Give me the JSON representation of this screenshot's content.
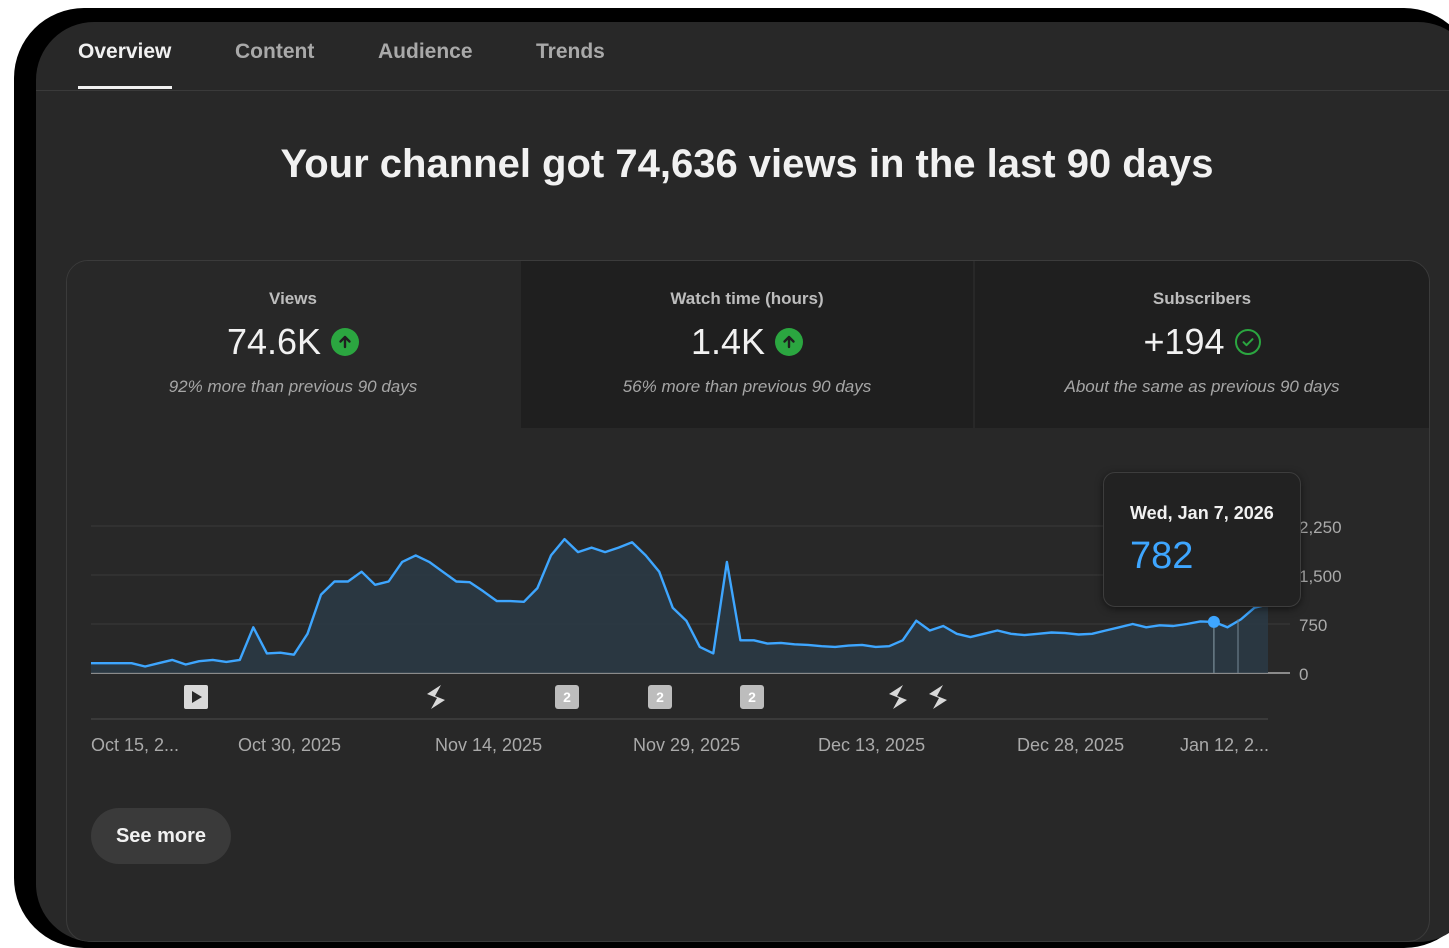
{
  "tabs": [
    {
      "label": "Overview",
      "active": true
    },
    {
      "label": "Content",
      "active": false
    },
    {
      "label": "Audience",
      "active": false
    },
    {
      "label": "Trends",
      "active": false
    }
  ],
  "headline": "Your channel got 74,636 views in the last 90 days",
  "metrics": [
    {
      "label": "Views",
      "value": "74.6K",
      "note": "92% more than previous 90 days",
      "trend_icon": "arrow-up-circle-icon"
    },
    {
      "label": "Watch time (hours)",
      "value": "1.4K",
      "note": "56% more than previous 90 days",
      "trend_icon": "arrow-up-circle-icon"
    },
    {
      "label": "Subscribers",
      "value": "+194",
      "note": "About the same as previous 90 days",
      "trend_icon": "check-circle-icon"
    }
  ],
  "tooltip": {
    "date": "Wed, Jan 7, 2026",
    "value": "782"
  },
  "see_more_label": "See more",
  "colors": {
    "line": "#3ea6ff",
    "positive": "#2ba640",
    "background": "#282828",
    "text": "#f1f1f1"
  },
  "chart_data": {
    "type": "area",
    "y_ticks": [
      "2,250",
      "1,500",
      "750",
      "0"
    ],
    "y_tick_values": [
      2250,
      1500,
      750,
      0
    ],
    "ylim": [
      0,
      2250
    ],
    "x_tick_labels": [
      "Oct 15, 2...",
      "Oct 30, 2025",
      "Nov 14, 2025",
      "Nov 29, 2025",
      "Dec 13, 2025",
      "Dec 28, 2025",
      "Jan 12, 2..."
    ],
    "series": [
      {
        "values": [
          150,
          150,
          150,
          150,
          100,
          150,
          200,
          130,
          180,
          200,
          170,
          200,
          700,
          300,
          310,
          280,
          600,
          1200,
          1400,
          1400,
          1550,
          1350,
          1400,
          1700,
          1800,
          1700,
          1550,
          1400,
          1390,
          1250,
          1100,
          1100,
          1090,
          1300,
          1800,
          2050,
          1850,
          1920,
          1850,
          1920,
          2000,
          1800,
          1550,
          1000,
          800,
          400,
          300,
          1700,
          500,
          500,
          450,
          460,
          440,
          430,
          410,
          400,
          420,
          430,
          400,
          410,
          500,
          800,
          650,
          720,
          600,
          550,
          600,
          650,
          600,
          580,
          600,
          620,
          610,
          590,
          600,
          650,
          700,
          750,
          700,
          730,
          720,
          750,
          790,
          782,
          700,
          820,
          1000,
          1050
        ]
      }
    ],
    "markers": [
      {
        "type": "video",
        "label": ""
      },
      {
        "type": "short",
        "label": ""
      },
      {
        "type": "multi",
        "label": "2"
      },
      {
        "type": "multi",
        "label": "2"
      },
      {
        "type": "multi",
        "label": "2"
      },
      {
        "type": "short",
        "label": ""
      },
      {
        "type": "short",
        "label": ""
      }
    ],
    "highlight_index": 83,
    "grid": true
  }
}
